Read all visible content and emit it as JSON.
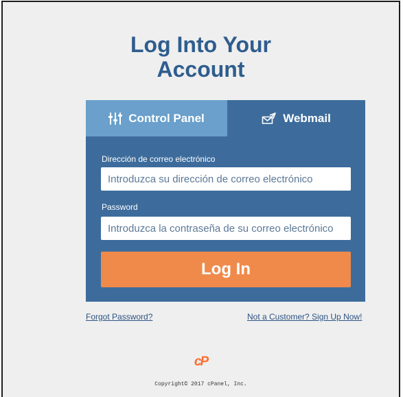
{
  "page": {
    "title_line1": "Log Into Your",
    "title_line2": "Account"
  },
  "tabs": [
    {
      "label": "Control Panel",
      "icon": "sliders-icon",
      "active": true
    },
    {
      "label": "Webmail",
      "icon": "envelope-send-icon",
      "active": false
    }
  ],
  "form": {
    "email_label": "Dirección de correo electrónico",
    "email_value": "",
    "email_placeholder": "Introduzca su dirección de correo electrónico",
    "password_label": "Password",
    "password_value": "",
    "password_placeholder": "Introduzca la contraseña de su correo electrónico",
    "login_label": "Log In"
  },
  "links": {
    "forgot": "Forgot Password?",
    "signup": "Not a Customer? Sign Up Now!"
  },
  "footer": {
    "logo_text": "cP",
    "copyright": "Copyright© 2017 cPanel, Inc."
  },
  "colors": {
    "title": "#2f5d8e",
    "panel_bg": "#3d6c9c",
    "active_tab": "#6aa0cb",
    "login_button": "#f08a4b",
    "link": "#2c5282",
    "logo": "#ff6c2c",
    "page_bg": "#efefef"
  }
}
